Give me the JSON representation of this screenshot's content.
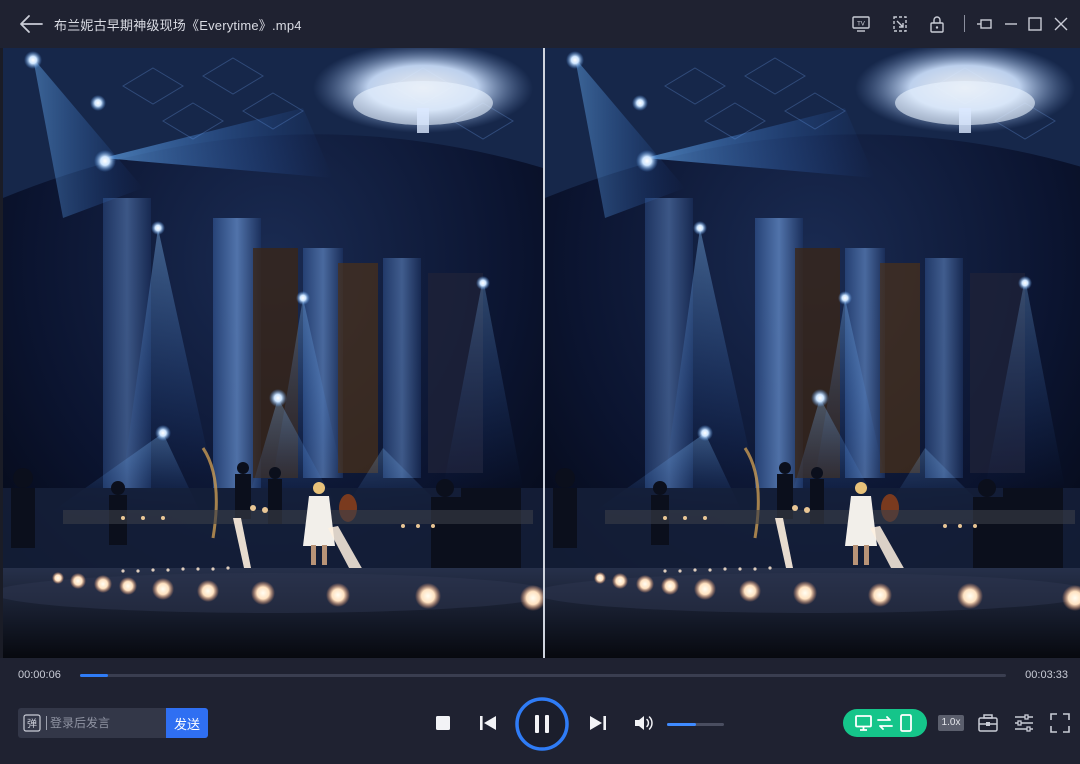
{
  "window": {
    "title": "布兰妮古早期神级现场《Everytime》.mp4",
    "titlebar_icons": [
      "back-arrow-icon",
      "tv-icon",
      "cast-icon",
      "lock-icon",
      "pin-window-icon",
      "minimize-icon",
      "maximize-icon",
      "close-icon"
    ]
  },
  "player": {
    "layout": "side-by-side-3d",
    "current_time": "00:00:06",
    "total_time": "00:03:33",
    "progress_fraction": 0.03,
    "volume_fraction": 0.5,
    "state": "playing"
  },
  "danmu": {
    "icon_label": "弹",
    "placeholder": "登录后发言",
    "send_label": "发送"
  },
  "controls": {
    "icons": [
      "stop-icon",
      "previous-icon",
      "pause-icon",
      "next-icon",
      "volume-icon",
      "screen-mode-icon",
      "screenshot-icon",
      "equalizer-icon",
      "fullscreen-icon"
    ],
    "speed_label": "1.0x"
  },
  "colors": {
    "background": "#1f2231",
    "accent_blue": "#2f7cf6",
    "send_button": "#2f6ff2",
    "mode_pill": "#15c58a"
  }
}
